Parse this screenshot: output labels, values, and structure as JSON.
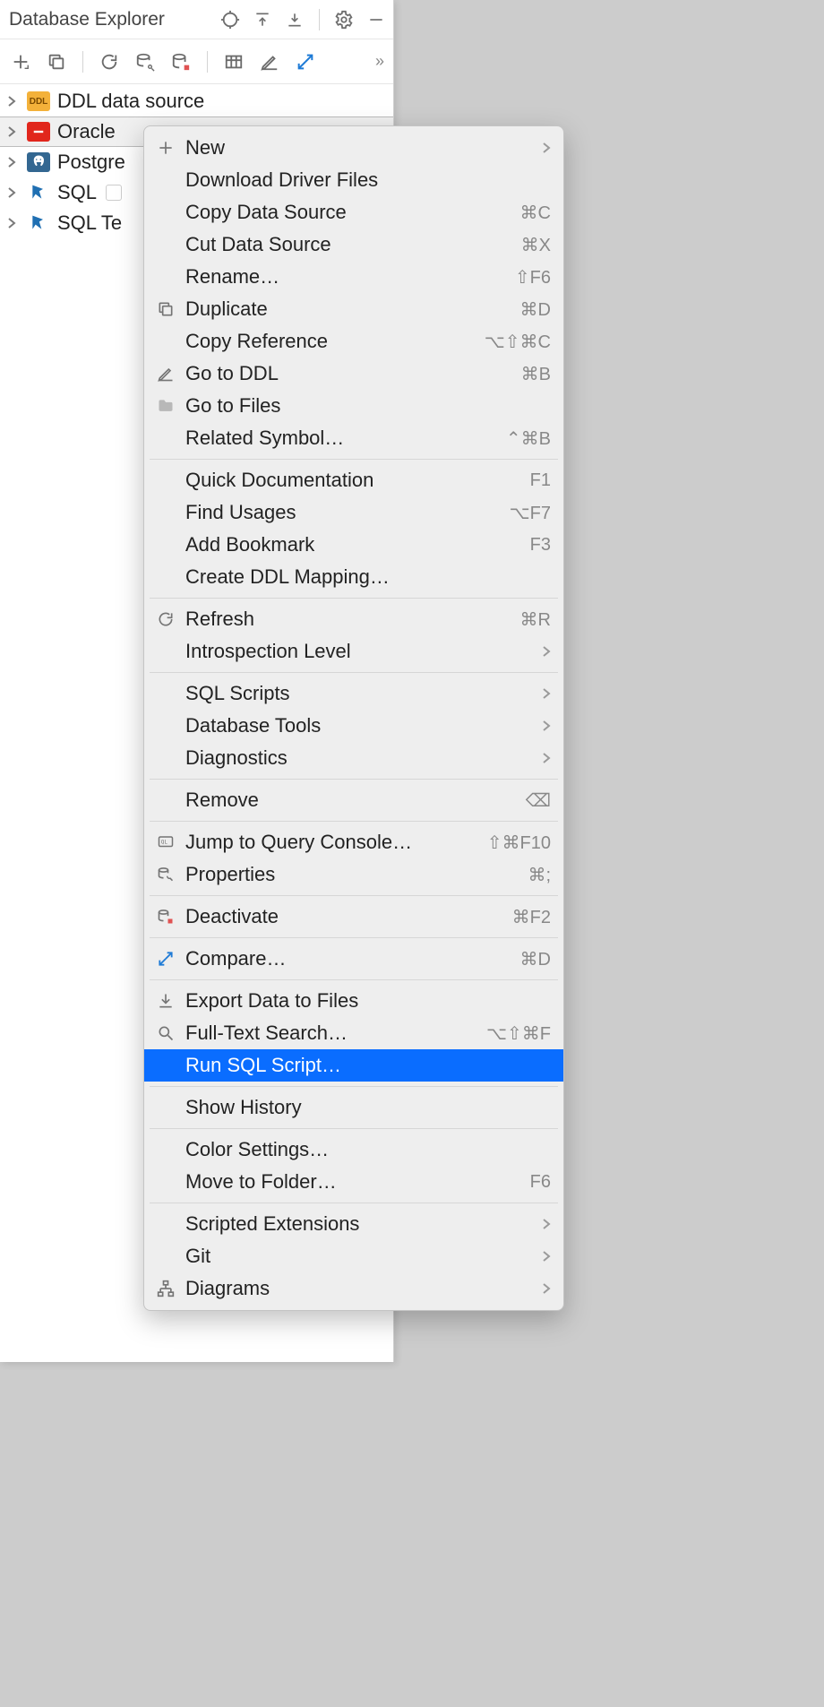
{
  "panel": {
    "title": "Database Explorer"
  },
  "tree": [
    {
      "label": "DDL data source",
      "icon_bg": "#f3b13a",
      "icon_text": "DDL",
      "icon_color": "#7a4a00",
      "selected": false,
      "badge": false
    },
    {
      "label": "Oracle",
      "icon_bg": "#e1261c",
      "icon_text": "",
      "icon_color": "#fff",
      "selected": true,
      "badge": false
    },
    {
      "label": "Postgre",
      "icon_bg": "#336791",
      "icon_text": "",
      "icon_color": "#fff",
      "selected": false,
      "badge": false
    },
    {
      "label": "SQL",
      "icon_bg": "#1f6fb2",
      "icon_text": "",
      "icon_color": "#fff",
      "selected": false,
      "badge": true
    },
    {
      "label": "SQL Te",
      "icon_bg": "#1f6fb2",
      "icon_text": "",
      "icon_color": "#fff",
      "selected": false,
      "badge": false
    }
  ],
  "menu": [
    {
      "type": "item",
      "icon": "plus",
      "label": "New",
      "shortcut": "",
      "submenu": true
    },
    {
      "type": "item",
      "icon": "",
      "label": "Download Driver Files",
      "shortcut": "",
      "submenu": false
    },
    {
      "type": "item",
      "icon": "",
      "label": "Copy Data Source",
      "shortcut": "⌘C",
      "submenu": false
    },
    {
      "type": "item",
      "icon": "",
      "label": "Cut Data Source",
      "shortcut": "⌘X",
      "submenu": false
    },
    {
      "type": "item",
      "icon": "",
      "label": "Rename…",
      "shortcut": "⇧F6",
      "submenu": false
    },
    {
      "type": "item",
      "icon": "duplicate",
      "label": "Duplicate",
      "shortcut": "⌘D",
      "submenu": false
    },
    {
      "type": "item",
      "icon": "",
      "label": "Copy Reference",
      "shortcut": "⌥⇧⌘C",
      "submenu": false
    },
    {
      "type": "item",
      "icon": "pencil",
      "label": "Go to DDL",
      "shortcut": "⌘B",
      "submenu": false
    },
    {
      "type": "item",
      "icon": "folder",
      "label": "Go to Files",
      "shortcut": "",
      "submenu": false
    },
    {
      "type": "item",
      "icon": "",
      "label": "Related Symbol…",
      "shortcut": "⌃⌘B",
      "submenu": false
    },
    {
      "type": "sep"
    },
    {
      "type": "item",
      "icon": "",
      "label": "Quick Documentation",
      "shortcut": "F1",
      "submenu": false
    },
    {
      "type": "item",
      "icon": "",
      "label": "Find Usages",
      "shortcut": "⌥F7",
      "submenu": false
    },
    {
      "type": "item",
      "icon": "",
      "label": "Add Bookmark",
      "shortcut": "F3",
      "submenu": false
    },
    {
      "type": "item",
      "icon": "",
      "label": "Create DDL Mapping…",
      "shortcut": "",
      "submenu": false
    },
    {
      "type": "sep"
    },
    {
      "type": "item",
      "icon": "refresh",
      "label": "Refresh",
      "shortcut": "⌘R",
      "submenu": false
    },
    {
      "type": "item",
      "icon": "",
      "label": "Introspection Level",
      "shortcut": "",
      "submenu": true
    },
    {
      "type": "sep"
    },
    {
      "type": "item",
      "icon": "",
      "label": "SQL Scripts",
      "shortcut": "",
      "submenu": true
    },
    {
      "type": "item",
      "icon": "",
      "label": "Database Tools",
      "shortcut": "",
      "submenu": true
    },
    {
      "type": "item",
      "icon": "",
      "label": "Diagnostics",
      "shortcut": "",
      "submenu": true
    },
    {
      "type": "sep"
    },
    {
      "type": "item",
      "icon": "",
      "label": "Remove",
      "shortcut": "⌫",
      "submenu": false
    },
    {
      "type": "sep"
    },
    {
      "type": "item",
      "icon": "console",
      "label": "Jump to Query Console…",
      "shortcut": "⇧⌘F10",
      "submenu": false
    },
    {
      "type": "item",
      "icon": "wrench",
      "label": "Properties",
      "shortcut": "⌘;",
      "submenu": false
    },
    {
      "type": "sep"
    },
    {
      "type": "item",
      "icon": "db-stop",
      "label": "Deactivate",
      "shortcut": "⌘F2",
      "submenu": false
    },
    {
      "type": "sep"
    },
    {
      "type": "item",
      "icon": "compare",
      "label": "Compare…",
      "shortcut": "⌘D",
      "submenu": false
    },
    {
      "type": "sep"
    },
    {
      "type": "item",
      "icon": "export",
      "label": "Export Data to Files",
      "shortcut": "",
      "submenu": false
    },
    {
      "type": "item",
      "icon": "search",
      "label": "Full-Text Search…",
      "shortcut": "⌥⇧⌘F",
      "submenu": false
    },
    {
      "type": "item",
      "icon": "",
      "label": "Run SQL Script…",
      "shortcut": "",
      "submenu": false,
      "highlight": true
    },
    {
      "type": "sep"
    },
    {
      "type": "item",
      "icon": "",
      "label": "Show History",
      "shortcut": "",
      "submenu": false
    },
    {
      "type": "sep"
    },
    {
      "type": "item",
      "icon": "",
      "label": "Color Settings…",
      "shortcut": "",
      "submenu": false
    },
    {
      "type": "item",
      "icon": "",
      "label": "Move to Folder…",
      "shortcut": "F6",
      "submenu": false
    },
    {
      "type": "sep"
    },
    {
      "type": "item",
      "icon": "",
      "label": "Scripted Extensions",
      "shortcut": "",
      "submenu": true
    },
    {
      "type": "item",
      "icon": "",
      "label": "Git",
      "shortcut": "",
      "submenu": true
    },
    {
      "type": "item",
      "icon": "diagram",
      "label": "Diagrams",
      "shortcut": "",
      "submenu": true
    }
  ]
}
